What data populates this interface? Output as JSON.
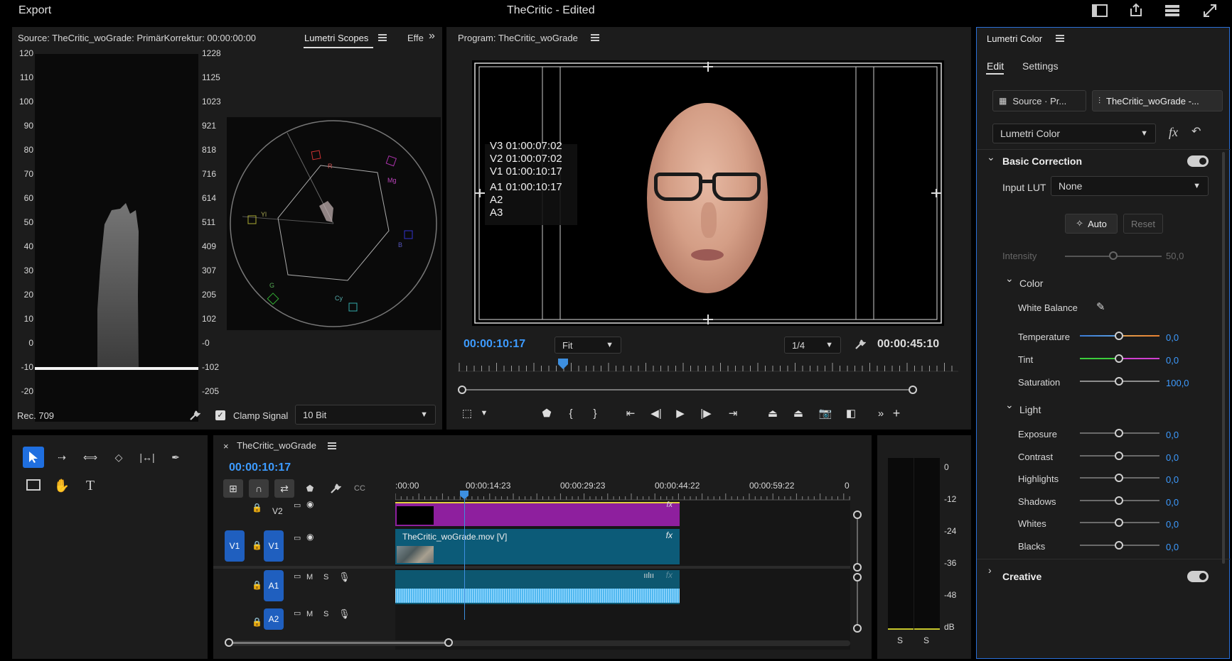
{
  "topbar": {
    "export_label": "Export",
    "title": "TheCritic - Edited"
  },
  "source_panel": {
    "title": "Source: TheCritic_woGrade: PrimärKorrektur: 00:00:00:00",
    "tab_scopes": "Lumetri Scopes",
    "tab_effects": "Effe",
    "left_scale": [
      "120",
      "110",
      "100",
      "90",
      "80",
      "70",
      "60",
      "50",
      "40",
      "30",
      "20",
      "10",
      "0",
      "-10",
      "-20"
    ],
    "right_scale": [
      "1228",
      "1125",
      "1023",
      "921",
      "818",
      "716",
      "614",
      "511",
      "409",
      "307",
      "205",
      "102",
      "-0",
      "-102",
      "-205"
    ],
    "vectorscope_labels": {
      "r": "R",
      "mg": "Mg",
      "yl": "Yl",
      "b": "B",
      "g": "G",
      "cy": "Cy"
    },
    "rec_label": "Rec. 709",
    "clamp_label": "Clamp Signal",
    "bit_depth": "10 Bit"
  },
  "program": {
    "title": "Program: TheCritic_woGrade",
    "overlay": [
      "V3 01:00:07:02",
      "V2 01:00:07:02",
      "V1 01:00:10:17",
      "A1 01:00:10:17",
      "A2",
      "A3"
    ],
    "timecode": "00:00:10:17",
    "fit": "Fit",
    "resolution": "1/4",
    "duration": "00:00:45:10"
  },
  "timeline": {
    "sequence_name": "TheCritic_woGrade",
    "timecode": "00:00:10:17",
    "ruler": [
      ":00:00",
      "00:00:14:23",
      "00:00:29:23",
      "00:00:44:22",
      "00:00:59:22",
      "0"
    ],
    "tracks": {
      "v2": "V2",
      "v1_src": "V1",
      "v1": "V1",
      "a1": "A1",
      "a2": "A2",
      "m": "M",
      "s": "S"
    },
    "clip_v1": "TheCritic_woGrade.mov [V]",
    "fx": "fx"
  },
  "meter": {
    "scale": [
      "0",
      "-12",
      "-24",
      "-36",
      "-48",
      "dB"
    ],
    "solo": [
      "S",
      "S"
    ]
  },
  "lumetri": {
    "title": "Lumetri Color",
    "tab_edit": "Edit",
    "tab_settings": "Settings",
    "source_btn": "Source · Pr...",
    "clip_btn": "TheCritic_woGrade -...",
    "effect_select": "Lumetri Color",
    "basic_correction": "Basic Correction",
    "input_lut_label": "Input LUT",
    "input_lut_value": "None",
    "auto": "Auto",
    "reset": "Reset",
    "intensity_label": "Intensity",
    "intensity_value": "50,0",
    "color_section": "Color",
    "white_balance": "White Balance",
    "temperature": {
      "label": "Temperature",
      "value": "0,0"
    },
    "tint": {
      "label": "Tint",
      "value": "0,0"
    },
    "saturation": {
      "label": "Saturation",
      "value": "100,0"
    },
    "light_section": "Light",
    "light": [
      {
        "label": "Exposure",
        "value": "0,0"
      },
      {
        "label": "Contrast",
        "value": "0,0"
      },
      {
        "label": "Highlights",
        "value": "0,0"
      },
      {
        "label": "Shadows",
        "value": "0,0"
      },
      {
        "label": "Whites",
        "value": "0,0"
      },
      {
        "label": "Blacks",
        "value": "0,0"
      }
    ],
    "creative": "Creative"
  },
  "colors": {
    "accent": "#3d9bff",
    "purple_clip": "#8e1f9e",
    "teal_clip": "#0c5b78"
  }
}
